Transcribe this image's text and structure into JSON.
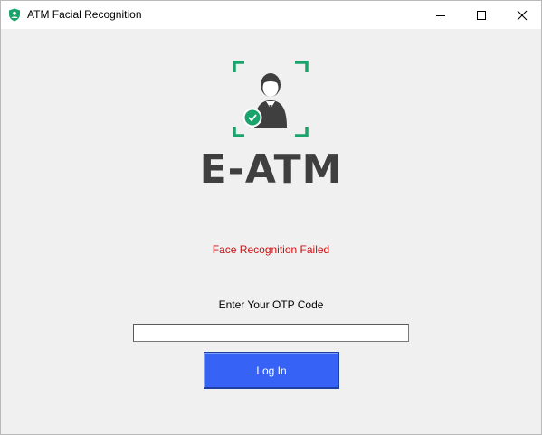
{
  "window": {
    "title": "ATM Facial Recognition",
    "app_icon": "shield-person-icon",
    "controls": {
      "minimize": "minimize-icon",
      "maximize": "maximize-icon",
      "close": "close-icon"
    }
  },
  "logo": {
    "icon": "face-scan-user-icon",
    "brand_text": "E-ATM"
  },
  "status": {
    "message": "Face Recognition Failed",
    "color": "#cc1111"
  },
  "otp": {
    "label": "Enter Your OTP Code",
    "value": "",
    "placeholder": ""
  },
  "login_button": {
    "label": "Log In",
    "color": "#3662f5"
  },
  "colors": {
    "accent_green": "#1aa36b",
    "brand_gray": "#3f3f3f",
    "background": "#f0f0f0"
  }
}
